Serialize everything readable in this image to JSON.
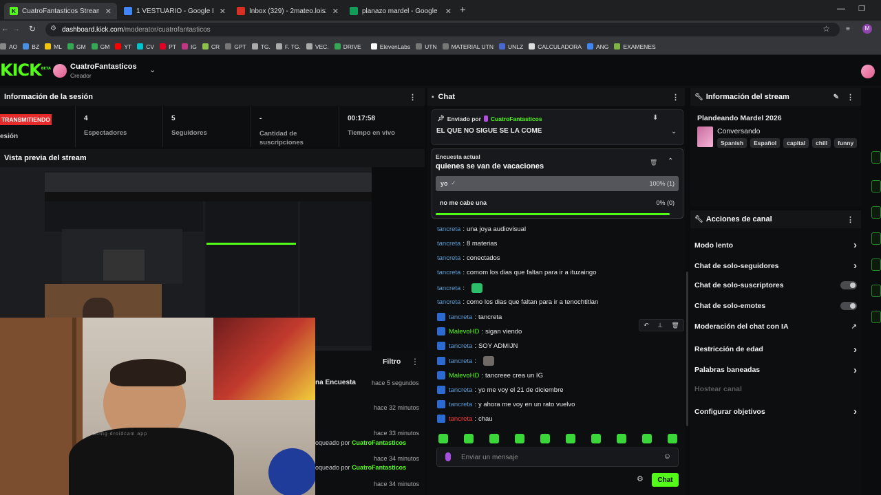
{
  "browser": {
    "tabs": [
      {
        "label": "CuatroFantasticos Stream - Kick",
        "color": "#53fc18",
        "icon": "kick-icon"
      },
      {
        "label": "1 VESTUARIO - Google Drive",
        "color": "#4285f4",
        "icon": "drive-icon"
      },
      {
        "label": "Inbox (329) - 2mateo.lois2007@",
        "color": "#d93025",
        "icon": "gmail-icon"
      },
      {
        "label": "planazo mardel - Google Sheets",
        "color": "#0f9d58",
        "icon": "sheets-icon"
      }
    ],
    "url_domain": "dashboard.kick.com",
    "url_path": "/moderator/cuatrofantasticos",
    "profile_initial": "M",
    "bookmarks": [
      "AO",
      "BZ",
      "ML",
      "GM",
      "GM",
      "YT",
      "CV",
      "PT",
      "IG",
      "CR",
      "GPT",
      "TG.",
      "F. TG.",
      "VEC.",
      "DRIVE",
      "ElevenLabs",
      "UTN",
      "MATERIAL UTN",
      "UNLZ",
      "CALCULADORA",
      "ANG",
      "EXAMENES"
    ]
  },
  "kick": {
    "logo": "KICK",
    "logo_beta": "BETA",
    "channel_name": "CuatroFantasticos",
    "channel_role": "Creador"
  },
  "session": {
    "title": "Información de la sesión",
    "live_badge": "TRANSMITIENDO",
    "session_label": "esión",
    "stats": [
      {
        "value": "4",
        "label": "Espectadores"
      },
      {
        "value": "5",
        "label": "Seguidores"
      },
      {
        "value": "-",
        "label": "Cantidad de suscripciones"
      },
      {
        "value": "00:17:58",
        "label": "Tiempo en vivo"
      }
    ]
  },
  "preview": {
    "title": "Vista previa del stream",
    "watermark": "using droidcam app"
  },
  "activity": {
    "filter_label": "Filtro",
    "items": [
      {
        "text": "na Encuesta",
        "time": "hace 5 segundos"
      },
      {
        "text": "",
        "time": "hace 32 minutos"
      },
      {
        "text": "",
        "time": "hace 33 minutos"
      },
      {
        "text": "oqueado por",
        "user": "CuatroFantasticos",
        "time": ""
      },
      {
        "text": "",
        "time": "hace 34 minutos"
      },
      {
        "text": "oqueado por",
        "user": "CuatroFantasticos",
        "time": ""
      },
      {
        "text": "",
        "time": "hace 34 minutos"
      }
    ]
  },
  "chat": {
    "title": "Chat",
    "pinned_prefix": "Enviado por",
    "pinned_user": "CuatroFantasticos",
    "pinned_message": "EL QUE NO SIGUE SE LA COME",
    "poll_label": "Encuesta actual",
    "poll_question": "quienes se van de vacaciones",
    "poll_options": [
      {
        "label": "yo",
        "result": "100% (1)",
        "share": 1.0
      },
      {
        "label": "no me cabe una",
        "result": "0% (0)",
        "share": 0.0
      }
    ],
    "messages": [
      {
        "user": "tancreta",
        "text": "una joya audiovisual",
        "badge": false,
        "style": "blue"
      },
      {
        "user": "tancreta",
        "text": "8 materias",
        "badge": false,
        "style": "blue"
      },
      {
        "user": "tancreta",
        "text": "conectados",
        "badge": false,
        "style": "blue"
      },
      {
        "user": "tancreta",
        "text": "comom los dias que faltan para ir a ituzaingo",
        "badge": false,
        "style": "blue"
      },
      {
        "user": "tancreta",
        "text": "",
        "badge": false,
        "style": "blue",
        "emote": true
      },
      {
        "user": "tancreta",
        "text": "como los dias que faltan para ir a tenochtitlan",
        "badge": false,
        "style": "blue"
      },
      {
        "user": "tancreta",
        "text": "tancreta",
        "badge": true,
        "style": "blue"
      },
      {
        "user": "MalevoHD",
        "text": "sigan viendo",
        "badge": true,
        "style": "green"
      },
      {
        "user": "tancreta",
        "text": "SOY ADMIJN",
        "badge": true,
        "style": "blue"
      },
      {
        "user": "tancreta",
        "text": "",
        "badge": true,
        "style": "blue",
        "emote": true
      },
      {
        "user": "MalevoHD",
        "text": "tancreee crea un IG",
        "badge": true,
        "style": "green"
      },
      {
        "user": "tancreta",
        "text": "yo me voy el 21 de diciembre",
        "badge": true,
        "style": "blue"
      },
      {
        "user": "tancreta",
        "text": "y ahora me voy en un rato vuelvo",
        "badge": true,
        "style": "blue"
      },
      {
        "user": "tancreta",
        "text": "chau",
        "badge": true,
        "style": "red"
      }
    ],
    "input_placeholder": "Enviar un mensaje",
    "send_label": "Chat"
  },
  "stream_info": {
    "title": "Información del stream",
    "stream_title": "Plandeando Mardel 2026",
    "category": "Conversando",
    "tags": [
      "Spanish",
      "Español",
      "capital",
      "chill",
      "funny"
    ]
  },
  "channel_actions": {
    "title": "Acciones de canal",
    "items": [
      {
        "label": "Modo lento",
        "control": "arrow"
      },
      {
        "label": "Chat de solo-seguidores",
        "control": "arrow"
      },
      {
        "label": "Chat de solo-suscriptores",
        "control": "toggle"
      },
      {
        "label": "Chat de solo-emotes",
        "control": "toggle"
      },
      {
        "label": "Moderación del chat con IA",
        "control": "external"
      },
      {
        "label": "Restricción de edad",
        "control": "arrow"
      },
      {
        "label": "Palabras baneadas",
        "control": "arrow"
      },
      {
        "label": "Hostear canal",
        "control": "disabled"
      },
      {
        "label": "Configurar objetivos",
        "control": "arrow"
      }
    ]
  },
  "colors": {
    "accent": "#53fc18",
    "live": "#ff2b2b",
    "username": "#5b9bd5"
  }
}
